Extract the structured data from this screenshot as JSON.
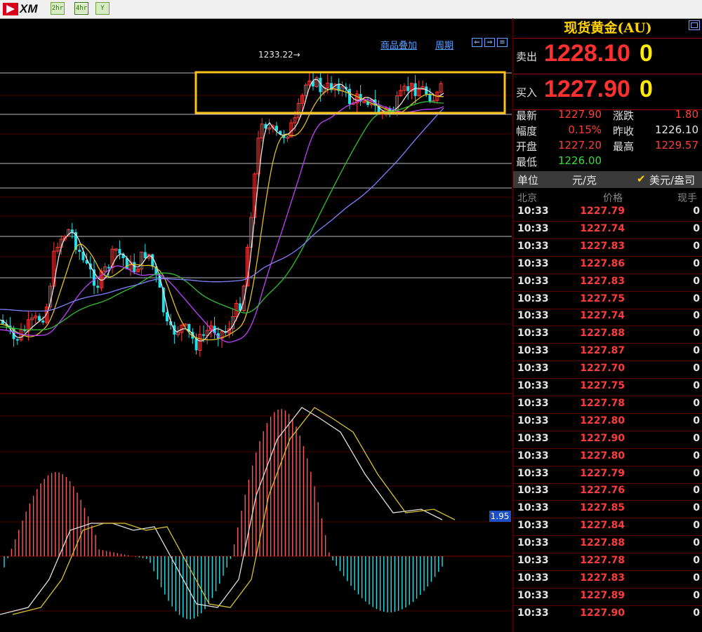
{
  "toolbar": {
    "logo_text": "XM",
    "buttons": [
      {
        "label": "2hr"
      },
      {
        "label": "4hr"
      },
      {
        "label": "Y"
      }
    ]
  },
  "chart_header": {
    "overlay_label": "商品叠加",
    "period_label": "周期"
  },
  "chart_annotations": {
    "high_marker": "1233.22→",
    "macd_value": "1.95"
  },
  "colors": {
    "up": "#ff3b3b",
    "down": "#22e0e8",
    "highlight_box": "#ffc21a",
    "ma_white": "#e6e6e6",
    "ma_yellow": "#e0c020",
    "ma_purple": "#c040ff",
    "ma_green": "#30c030",
    "ma_blue": "#8080ff"
  },
  "panel": {
    "title": "现货黄金(AU)",
    "sell_label": "卖出",
    "sell_price": "1228.10",
    "sell_vol": "0",
    "buy_label": "买入",
    "buy_price": "1227.90",
    "buy_vol": "0",
    "stats": [
      {
        "label": "最新",
        "value": "1227.90",
        "color": "#ff3b3b"
      },
      {
        "label": "涨跌",
        "value": "1.80",
        "color": "#ff3b3b"
      },
      {
        "label": "幅度",
        "value": "0.15%",
        "color": "#ff3b3b"
      },
      {
        "label": "昨收",
        "value": "1226.10",
        "color": "#e6e6e6"
      },
      {
        "label": "开盘",
        "value": "1227.20",
        "color": "#ff3b3b"
      },
      {
        "label": "最高",
        "value": "1229.57",
        "color": "#ff3b3b"
      },
      {
        "label": "最低",
        "value": "1226.00",
        "color": "#30e030"
      }
    ],
    "unit_label": "单位",
    "unit_value": "元/克",
    "unit_option": "美元/盎司",
    "tick_headers": {
      "time": "北京",
      "price": "价格",
      "vol": "现手"
    },
    "ticks": [
      {
        "time": "10:33",
        "price": "1227.79",
        "vol": "0"
      },
      {
        "time": "10:33",
        "price": "1227.74",
        "vol": "0"
      },
      {
        "time": "10:33",
        "price": "1227.83",
        "vol": "0"
      },
      {
        "time": "10:33",
        "price": "1227.86",
        "vol": "0"
      },
      {
        "time": "10:33",
        "price": "1227.83",
        "vol": "0"
      },
      {
        "time": "10:33",
        "price": "1227.75",
        "vol": "0"
      },
      {
        "time": "10:33",
        "price": "1227.74",
        "vol": "0"
      },
      {
        "time": "10:33",
        "price": "1227.88",
        "vol": "0"
      },
      {
        "time": "10:33",
        "price": "1227.87",
        "vol": "0"
      },
      {
        "time": "10:33",
        "price": "1227.70",
        "vol": "0"
      },
      {
        "time": "10:33",
        "price": "1227.75",
        "vol": "0"
      },
      {
        "time": "10:33",
        "price": "1227.78",
        "vol": "0"
      },
      {
        "time": "10:33",
        "price": "1227.80",
        "vol": "0"
      },
      {
        "time": "10:33",
        "price": "1227.90",
        "vol": "0"
      },
      {
        "time": "10:33",
        "price": "1227.80",
        "vol": "0"
      },
      {
        "time": "10:33",
        "price": "1227.79",
        "vol": "0"
      },
      {
        "time": "10:33",
        "price": "1227.76",
        "vol": "0"
      },
      {
        "time": "10:33",
        "price": "1227.85",
        "vol": "0"
      },
      {
        "time": "10:33",
        "price": "1227.84",
        "vol": "0"
      },
      {
        "time": "10:33",
        "price": "1227.88",
        "vol": "0"
      },
      {
        "time": "10:33",
        "price": "1227.78",
        "vol": "0"
      },
      {
        "time": "10:33",
        "price": "1227.83",
        "vol": "0"
      },
      {
        "time": "10:33",
        "price": "1227.89",
        "vol": "0"
      },
      {
        "time": "10:33",
        "price": "1227.90",
        "vol": "0"
      }
    ]
  }
}
